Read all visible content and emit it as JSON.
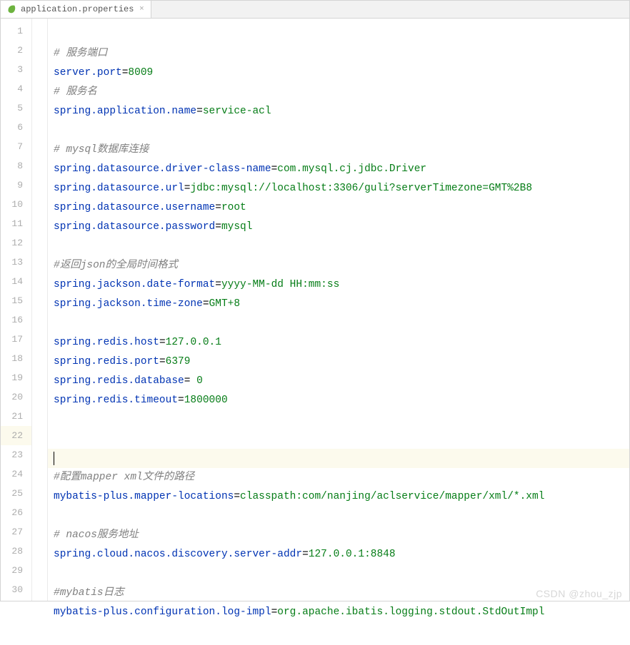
{
  "tab": {
    "filename": "application.properties",
    "close_label": "×"
  },
  "lines": [
    {
      "n": 1,
      "type": "comment",
      "text": "# 服务端口"
    },
    {
      "n": 2,
      "type": "kv",
      "key": "server.port",
      "val": "8009"
    },
    {
      "n": 3,
      "type": "comment",
      "text": "# 服务名"
    },
    {
      "n": 4,
      "type": "kv",
      "key": "spring.application.name",
      "val": "service-acl"
    },
    {
      "n": 5,
      "type": "blank",
      "text": ""
    },
    {
      "n": 6,
      "type": "comment",
      "text": "# mysql数据库连接"
    },
    {
      "n": 7,
      "type": "kv",
      "key": "spring.datasource.driver-class-name",
      "val": "com.mysql.cj.jdbc.Driver"
    },
    {
      "n": 8,
      "type": "kv",
      "key": "spring.datasource.url",
      "val": "jdbc:mysql://localhost:3306/guli?serverTimezone=GMT%2B8"
    },
    {
      "n": 9,
      "type": "kv",
      "key": "spring.datasource.username",
      "val": "root"
    },
    {
      "n": 10,
      "type": "kv",
      "key": "spring.datasource.password",
      "val": "mysql"
    },
    {
      "n": 11,
      "type": "blank",
      "text": ""
    },
    {
      "n": 12,
      "type": "comment",
      "text": "#返回json的全局时间格式"
    },
    {
      "n": 13,
      "type": "kv",
      "key": "spring.jackson.date-format",
      "val": "yyyy-MM-dd HH:mm:ss"
    },
    {
      "n": 14,
      "type": "kv",
      "key": "spring.jackson.time-zone",
      "val": "GMT+8"
    },
    {
      "n": 15,
      "type": "blank",
      "text": ""
    },
    {
      "n": 16,
      "type": "kv",
      "key": "spring.redis.host",
      "val": "127.0.0.1"
    },
    {
      "n": 17,
      "type": "kv",
      "key": "spring.redis.port",
      "val": "6379"
    },
    {
      "n": 18,
      "type": "kv_sp",
      "key": "spring.redis.database",
      "val": "0"
    },
    {
      "n": 19,
      "type": "kv",
      "key": "spring.redis.timeout",
      "val": "1800000"
    },
    {
      "n": 20,
      "type": "blank",
      "text": ""
    },
    {
      "n": 21,
      "type": "blank",
      "text": ""
    },
    {
      "n": 22,
      "type": "current",
      "text": ""
    },
    {
      "n": 23,
      "type": "comment",
      "text": "#配置mapper xml文件的路径"
    },
    {
      "n": 24,
      "type": "kv",
      "key": "mybatis-plus.mapper-locations",
      "val": "classpath:com/nanjing/aclservice/mapper/xml/*.xml"
    },
    {
      "n": 25,
      "type": "blank",
      "text": ""
    },
    {
      "n": 26,
      "type": "comment",
      "text": "# nacos服务地址"
    },
    {
      "n": 27,
      "type": "kv",
      "key": "spring.cloud.nacos.discovery.server-addr",
      "val": "127.0.0.1:8848"
    },
    {
      "n": 28,
      "type": "blank",
      "text": ""
    },
    {
      "n": 29,
      "type": "comment",
      "text": "#mybatis日志"
    },
    {
      "n": 30,
      "type": "kv",
      "key": "mybatis-plus.configuration.log-impl",
      "val": "org.apache.ibatis.logging.stdout.StdOutImpl"
    }
  ],
  "watermark": "CSDN @zhou_zjp"
}
